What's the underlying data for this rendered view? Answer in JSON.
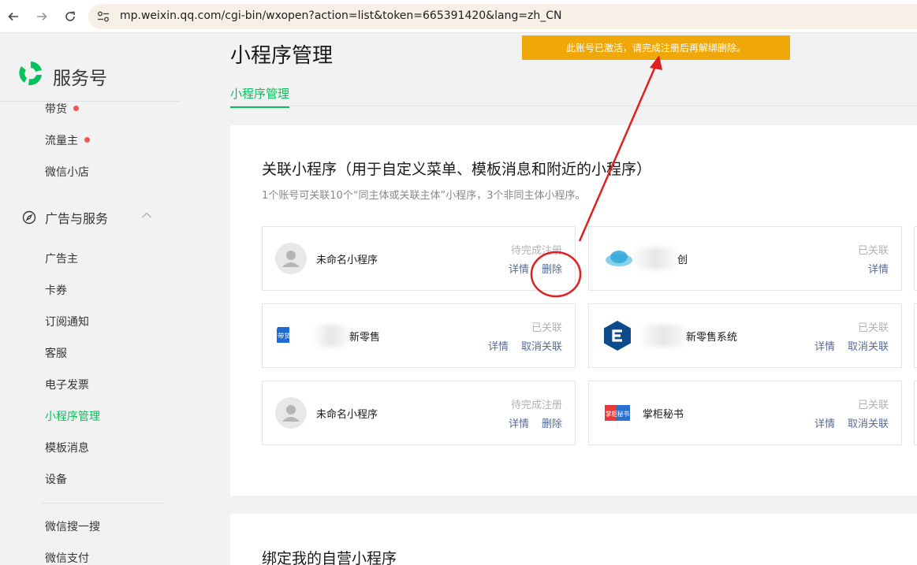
{
  "browser": {
    "url": "mp.weixin.qq.com/cgi-bin/wxopen?action=list&token=665391420&lang=zh_CN"
  },
  "sidebar": {
    "brand": "服务号",
    "items": [
      {
        "label": "带货",
        "badge": true
      },
      {
        "label": "流量主",
        "badge": true
      },
      {
        "label": "微信小店"
      }
    ],
    "group": {
      "title": "广告与服务",
      "items": [
        "广告主",
        "卡券",
        "订阅通知",
        "客服",
        "电子发票",
        "小程序管理",
        "模板消息",
        "设备"
      ]
    },
    "active_item": "小程序管理",
    "bottom_items": [
      "微信搜一搜",
      "微信支付"
    ]
  },
  "header": {
    "title": "小程序管理",
    "tabs": [
      "小程序管理"
    ]
  },
  "warning": {
    "text": "此账号已激活，请完成注册后再解绑删除。"
  },
  "section": {
    "title": "关联小程序（用于自定义菜单、模板消息和附近的小程序）",
    "desc": "1个账号可关联10个“同主体或关联主体”小程序，3个非同主体小程序。"
  },
  "section2": {
    "title": "绑定我的自营小程序"
  },
  "cards": [
    {
      "name": "未命名小程序",
      "status": "待完成注册",
      "actions": [
        "详情",
        "删除"
      ]
    },
    {
      "name": "创",
      "status": "已关联",
      "actions": [
        "详情"
      ]
    },
    {
      "name": "新零售",
      "status": "已关联",
      "actions": [
        "详情",
        "取消关联"
      ]
    },
    {
      "name": "新零售系统",
      "status": "已关联",
      "actions": [
        "详情",
        "取消关联"
      ]
    },
    {
      "name": "未命名小程序",
      "status": "待完成注册",
      "actions": [
        "详情",
        "删除"
      ]
    },
    {
      "name": "掌柜秘书",
      "status": "已关联",
      "actions": [
        "详情",
        "取消关联"
      ]
    }
  ],
  "logos": {
    "daihuo": "带货秘书",
    "zhanggui": "掌柜秘书"
  },
  "colors": {
    "accent": "#07c160",
    "link": "#576b95",
    "warning": "#f0a70a",
    "badge": "#fa5151",
    "annotation": "#e02020"
  }
}
